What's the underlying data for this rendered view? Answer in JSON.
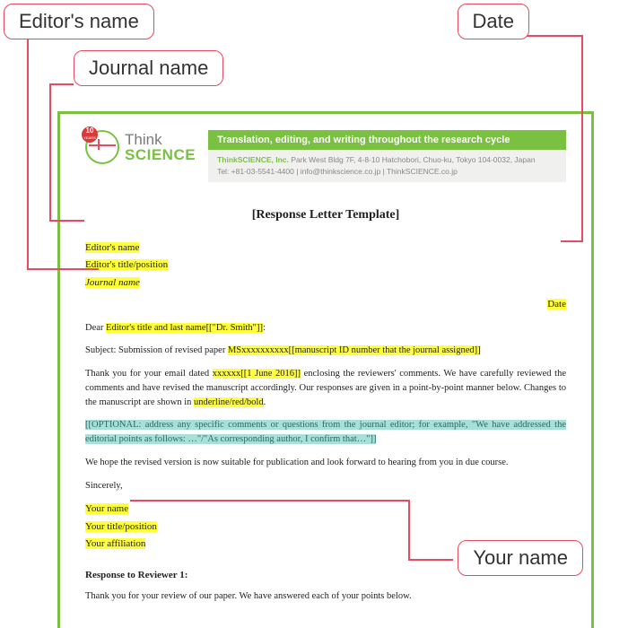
{
  "callouts": {
    "editor": "Editor's name",
    "date": "Date",
    "journal": "Journal name",
    "yourname": "Your name"
  },
  "letterhead": {
    "logo_badge_top": "10",
    "logo_badge_bottom": "YEARS",
    "logo_think": "Think",
    "logo_science": "SCIENCE",
    "banner": "Translation, editing, and writing throughout the research cycle",
    "company": "ThinkSCIENCE, Inc.",
    "address": "Park West Bldg 7F, 4-8-10 Hatchobori, Chuo-ku, Tokyo 104-0032, Japan",
    "contact": "Tel: +81-03-5541-4400 | info@thinkscience.co.jp | ThinkSCIENCE.co.jp"
  },
  "doc": {
    "title": "[Response Letter Template]",
    "editor_name": "Editor's name",
    "editor_title": "Editor's title/position",
    "journal_name": "Journal name",
    "date": "Date",
    "dear_prefix": "Dear ",
    "dear_hl": "Editor's title and last name[[\"Dr. Smith\"]]",
    "dear_suffix": ":",
    "subject_prefix": "Subject: Submission of revised paper ",
    "subject_hl": "MSxxxxxxxxxx[[manuscript ID number that the journal assigned]]",
    "thank_prefix": "Thank you for your email dated ",
    "thank_date": "xxxxxx[[1 June 2016]]",
    "thank_mid": " enclosing the reviewers' comments. We have carefully reviewed the comments and have revised the manuscript accordingly. Our responses are given in a point-by-point manner below. Changes to the manuscript are shown in ",
    "thank_fmt": "underline/red/bold",
    "thank_suffix": ".",
    "optional": "[[OPTIONAL: address any specific comments or questions from the journal editor; for example, \"We have addressed the editorial points as follows: …\"/\"As corresponding author, I confirm that…\"]]",
    "hope": "We hope the revised version is now suitable for publication and look forward to hearing from you in due course.",
    "sincerely": "Sincerely,",
    "your_name": "Your name",
    "your_title": "Your title/position",
    "your_affiliation": "Your affiliation",
    "resp_header": "Response to Reviewer 1:",
    "resp_intro": "Thank you for your review of our paper. We have answered each of your points below."
  }
}
